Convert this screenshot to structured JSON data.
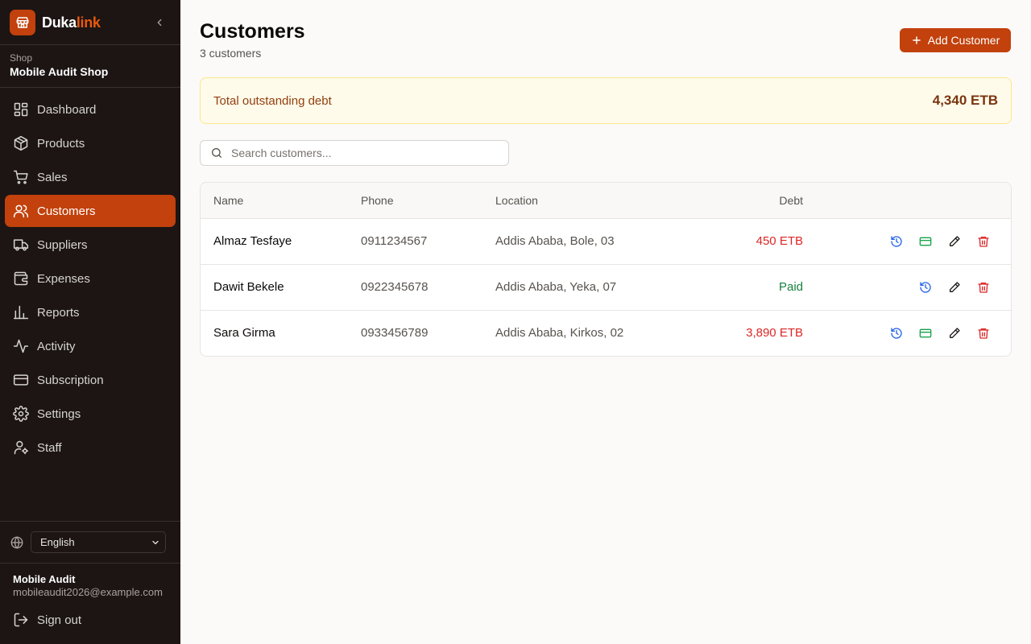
{
  "brand": {
    "name_part1": "Duka",
    "name_part2": "link"
  },
  "shop": {
    "label": "Shop",
    "name": "Mobile Audit Shop"
  },
  "nav": {
    "items": [
      {
        "label": "Dashboard",
        "icon": "dashboard-icon"
      },
      {
        "label": "Products",
        "icon": "box-icon"
      },
      {
        "label": "Sales",
        "icon": "cart-icon"
      },
      {
        "label": "Customers",
        "icon": "users-icon",
        "active": true
      },
      {
        "label": "Suppliers",
        "icon": "truck-icon"
      },
      {
        "label": "Expenses",
        "icon": "wallet-icon"
      },
      {
        "label": "Reports",
        "icon": "bar-chart-icon"
      },
      {
        "label": "Activity",
        "icon": "activity-icon"
      },
      {
        "label": "Subscription",
        "icon": "credit-card-icon"
      },
      {
        "label": "Settings",
        "icon": "gear-icon"
      },
      {
        "label": "Staff",
        "icon": "user-cog-icon"
      }
    ]
  },
  "language": {
    "selected": "English"
  },
  "user": {
    "name": "Mobile Audit",
    "email": "mobileaudit2026@example.com"
  },
  "signout_label": "Sign out",
  "page": {
    "title": "Customers",
    "subtitle": "3 customers",
    "add_button": "Add Customer"
  },
  "summary": {
    "label": "Total outstanding debt",
    "value": "4,340 ETB"
  },
  "search": {
    "placeholder": "Search customers..."
  },
  "table": {
    "headers": {
      "name": "Name",
      "phone": "Phone",
      "location": "Location",
      "debt": "Debt"
    },
    "rows": [
      {
        "name": "Almaz Tesfaye",
        "phone": "0911234567",
        "location": "Addis Ababa, Bole, 03",
        "debt": "450 ETB",
        "status": "owing"
      },
      {
        "name": "Dawit Bekele",
        "phone": "0922345678",
        "location": "Addis Ababa, Yeka, 07",
        "debt": "Paid",
        "status": "paid"
      },
      {
        "name": "Sara Girma",
        "phone": "0933456789",
        "location": "Addis Ababa, Kirkos, 02",
        "debt": "3,890 ETB",
        "status": "owing"
      }
    ]
  },
  "colors": {
    "accent": "#c2410c",
    "sidebar_bg": "#1c1514",
    "debt_red": "#dc2626",
    "paid_green": "#15803d",
    "history_blue": "#2563eb",
    "payment_green": "#16a34a"
  }
}
